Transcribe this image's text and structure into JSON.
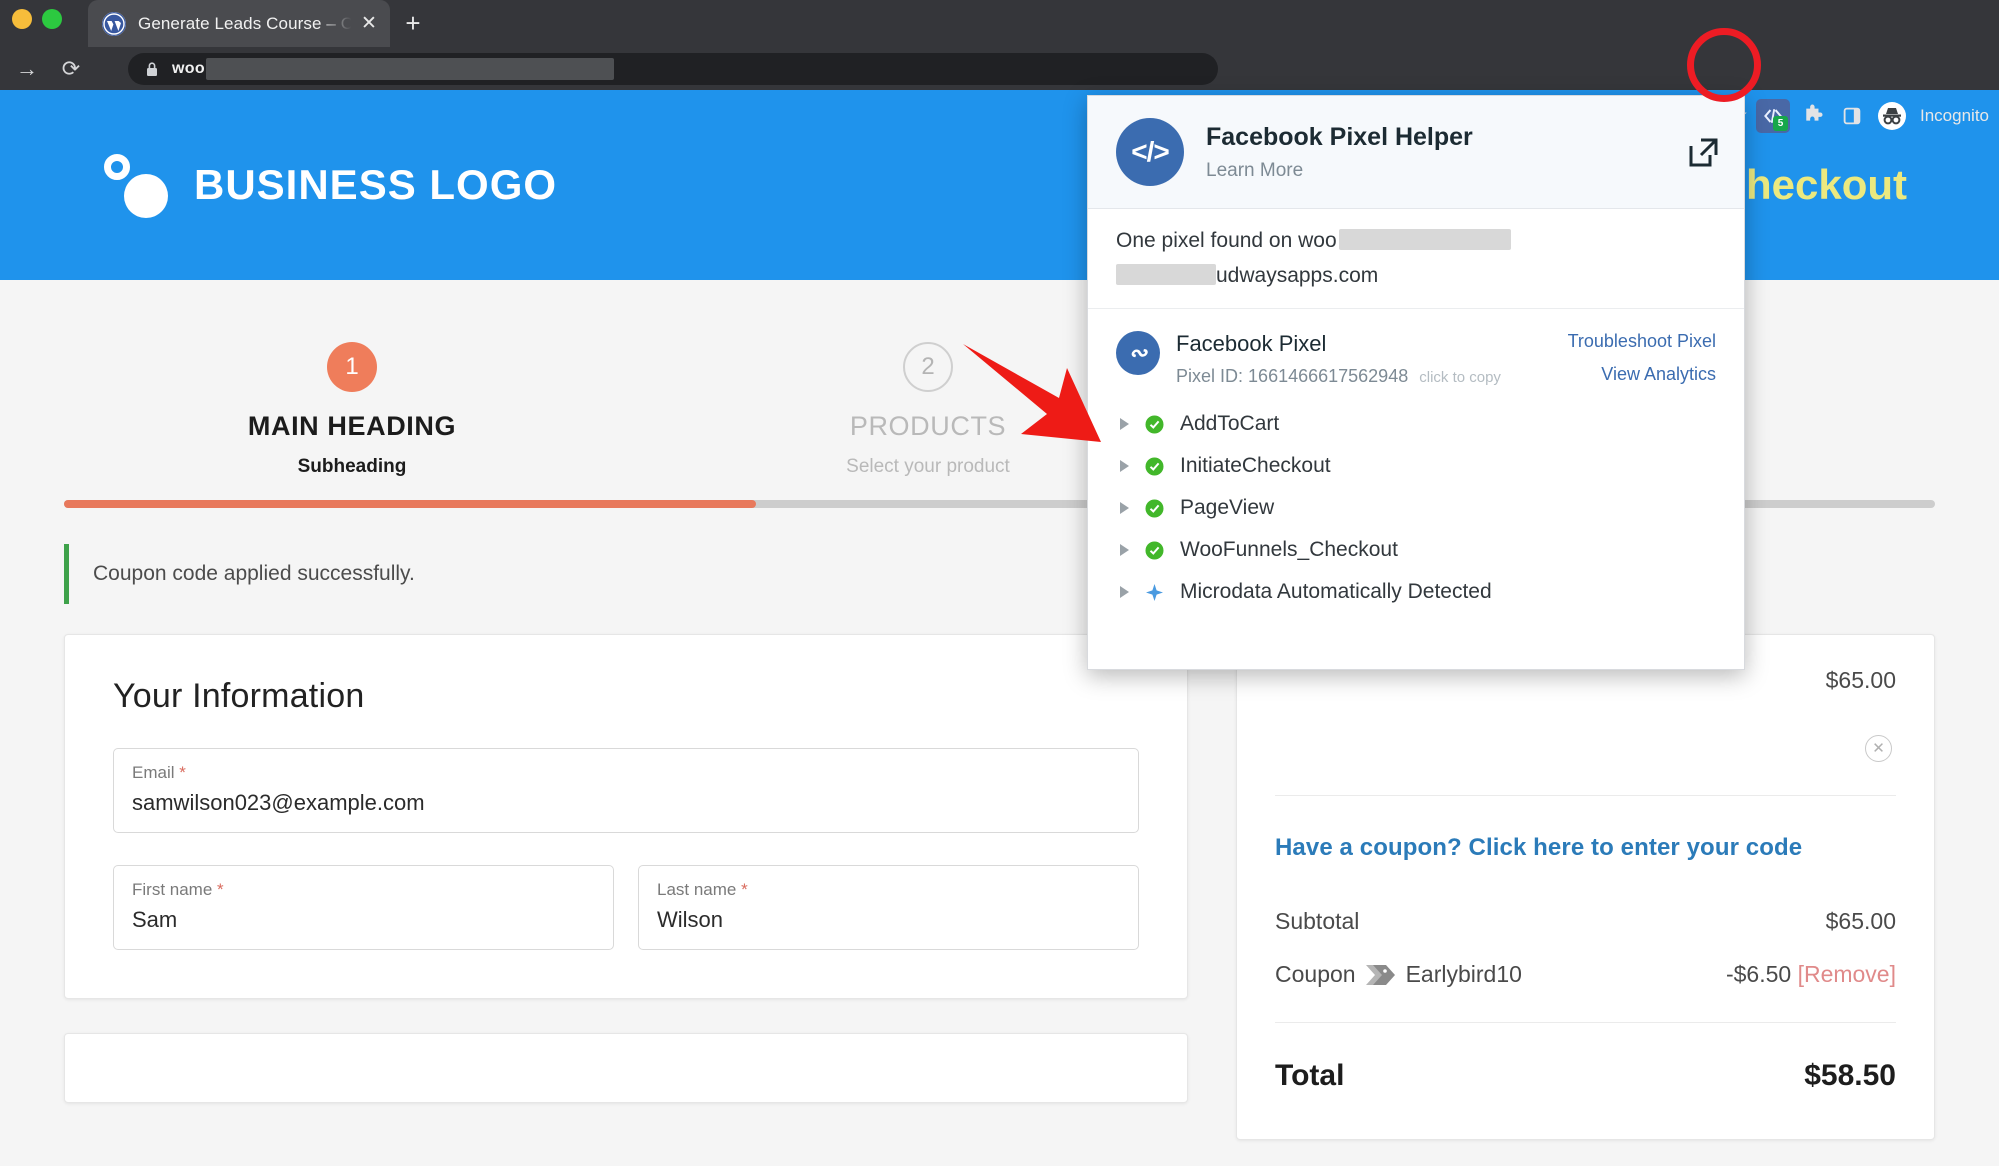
{
  "browser": {
    "tab": {
      "title": "Generate Leads Course – Chec",
      "favicon": "wordpress-icon",
      "close": "✕"
    },
    "new_tab": "+",
    "nav": {
      "forward": "→",
      "reload": "⟳"
    },
    "omnibox": {
      "url_visible": "woo",
      "lock": "lock-icon"
    },
    "toolbar_right": {
      "extension_badge": "5",
      "profile_label": "Incognito"
    }
  },
  "site": {
    "logo_text": "BUSINESS LOGO",
    "page_title": "Checkout"
  },
  "steps": [
    {
      "number": "1",
      "title": "MAIN HEADING",
      "sub": "Subheading",
      "state": "active"
    },
    {
      "number": "2",
      "title": "PRODUCTS",
      "sub": "Select your product",
      "state": "idle"
    }
  ],
  "progress_percent": 37,
  "notice": {
    "text": "Coupon code applied successfully.",
    "accent": "#3ea24a"
  },
  "form": {
    "title": "Your Information",
    "fields": [
      {
        "label": "Email",
        "required": "*",
        "value": "samwilson023@example.com"
      },
      {
        "label": "First name",
        "required": "*",
        "value": "Sam"
      },
      {
        "label": "Last name",
        "required": "*",
        "value": "Wilson"
      }
    ]
  },
  "summary": {
    "item_price": "$65.00",
    "remove_item": "✕",
    "coupon_link": "Have a coupon? Click here to enter your code",
    "rows": [
      {
        "label": "Subtotal",
        "value": "$65.00"
      },
      {
        "label": "Coupon",
        "coupon_code": "Earlybird10",
        "value": "-$6.50",
        "remove": "[Remove]"
      }
    ],
    "total": {
      "label": "Total",
      "value": "$58.50"
    }
  },
  "pixel_helper": {
    "title": "Facebook Pixel Helper",
    "learn_more": "Learn More",
    "open_icon": "external-link-icon",
    "found_prefix": "One pixel found on woo",
    "found_suffix": "udwaysapps.com",
    "pixel_name": "Facebook Pixel",
    "pixel_id_label": "Pixel ID:",
    "pixel_id": "1661466617562948",
    "copy_hint": "click to copy",
    "links": [
      "Troubleshoot Pixel",
      "View Analytics"
    ],
    "events": [
      {
        "label": "AddToCart",
        "status": "ok"
      },
      {
        "label": "InitiateCheckout",
        "status": "ok"
      },
      {
        "label": "PageView",
        "status": "ok"
      },
      {
        "label": "WooFunnels_Checkout",
        "status": "ok"
      },
      {
        "label": "Microdata Automatically Detected",
        "status": "info"
      }
    ]
  },
  "annotations": {
    "arrow_color": "#ee1b16",
    "ring_color": "#ed1c24"
  }
}
